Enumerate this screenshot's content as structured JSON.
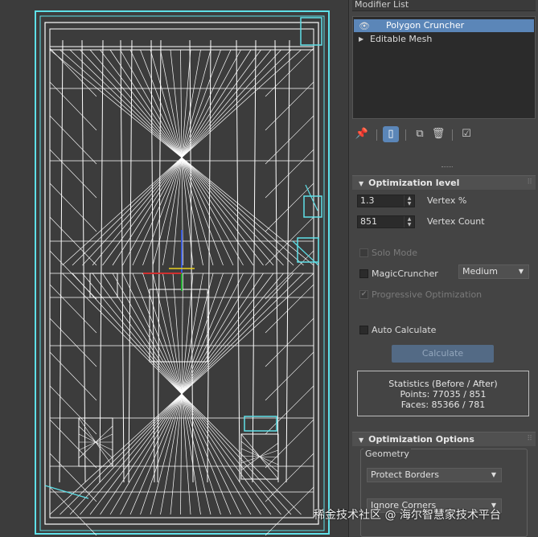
{
  "modifier_panel": {
    "header": "Modifier List",
    "stack": [
      {
        "label": "Polygon Cruncher",
        "selected": true,
        "icon": "eye-icon"
      },
      {
        "label": "Editable Mesh",
        "selected": false,
        "icon": "expand-triangle-icon"
      }
    ],
    "toolbar_icons": [
      "pin-stack-icon",
      "show-end-result-icon",
      "make-unique-icon",
      "remove-modifier-icon",
      "configure-modifier-sets-icon"
    ]
  },
  "optimization_level": {
    "title": "Optimization level",
    "vertex_pct_value": "1.3",
    "vertex_pct_label": "Vertex %",
    "vertex_count_value": "851",
    "vertex_count_label": "Vertex Count",
    "solo_mode_label": "Solo Mode",
    "magic_cruncher_label": "MagicCruncher",
    "magic_cruncher_option": "Medium",
    "progressive_label": "Progressive Optimization",
    "auto_calculate_label": "Auto Calculate",
    "calculate_label": "Calculate",
    "stats_title": "Statistics (Before / After)",
    "stats_points": "Points: 77035 / 851",
    "stats_faces": "Faces: 85366 / 781"
  },
  "optimization_options": {
    "title": "Optimization Options",
    "geometry_label": "Geometry",
    "protect_borders_option": "Protect Borders",
    "ignore_corners_option": "Ignore Corners"
  },
  "watermark": "稀金技术社区 @ 海尔智慧家技术平台",
  "colors": {
    "selection": "#5b86b8",
    "wire_white": "#ffffff",
    "wire_cyan": "#5ee0e8",
    "viewport_bg": "#3c3c3c",
    "panel_bg": "#444444"
  }
}
